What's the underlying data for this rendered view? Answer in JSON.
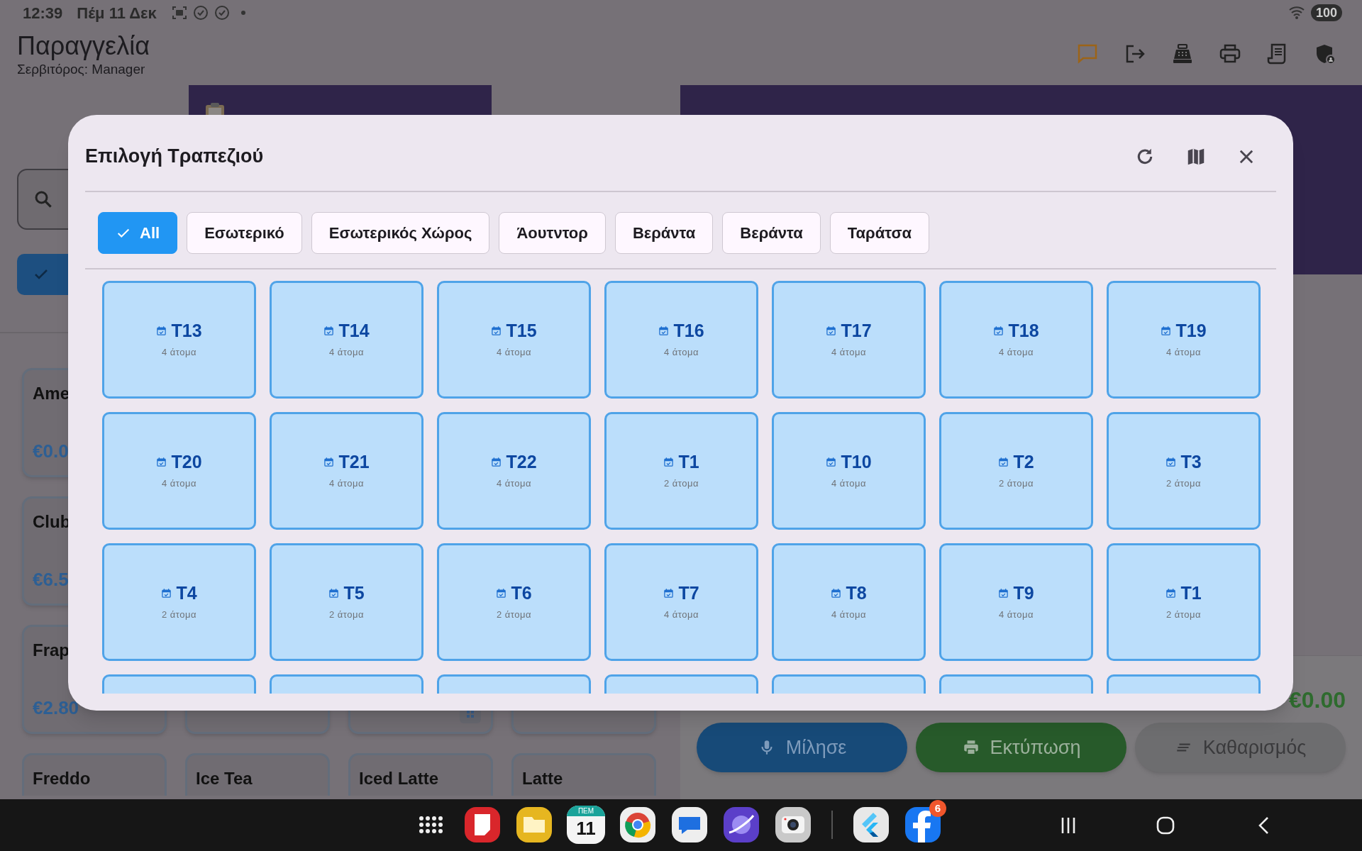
{
  "status_bar": {
    "time": "12:39",
    "date": "Πέμ 11 Δεκ",
    "battery": "100"
  },
  "header": {
    "title": "Παραγγελία",
    "subtitle": "Σερβιτόρος: Manager"
  },
  "catalog": {
    "product_rows": [
      [
        {
          "name": "Ame",
          "price": "€0.0"
        }
      ],
      [
        {
          "name": "Club",
          "price": "€6.5"
        }
      ],
      [
        {
          "name": "Frap",
          "price": "€2.80"
        },
        {},
        {},
        {}
      ],
      [
        {
          "name": "Freddo"
        },
        {
          "name": "Ice Tea"
        },
        {
          "name": "Iced Latte"
        },
        {
          "name": "Latte"
        }
      ]
    ]
  },
  "order": {
    "total": "€0.00",
    "buttons": [
      {
        "kind": "voice",
        "label": "Μίλησε"
      },
      {
        "kind": "print",
        "label": "Εκτύπωση"
      },
      {
        "kind": "clear",
        "label": "Καθαρισμός"
      }
    ]
  },
  "dialog": {
    "title": "Επιλογή Τραπεζιού",
    "filters": [
      {
        "label": "All",
        "selected": true
      },
      {
        "label": "Εσωτερικό",
        "selected": false
      },
      {
        "label": "Εσωτερικός Χώρος",
        "selected": false
      },
      {
        "label": "Άουτντορ",
        "selected": false
      },
      {
        "label": "Βεράντα",
        "selected": false
      },
      {
        "label": "Βεράντα",
        "selected": false
      },
      {
        "label": "Ταράτσα",
        "selected": false
      }
    ],
    "tables": [
      {
        "name": "T13",
        "seats": "4 άτομα"
      },
      {
        "name": "T14",
        "seats": "4 άτομα"
      },
      {
        "name": "T15",
        "seats": "4 άτομα"
      },
      {
        "name": "T16",
        "seats": "4 άτομα"
      },
      {
        "name": "T17",
        "seats": "4 άτομα"
      },
      {
        "name": "T18",
        "seats": "4 άτομα"
      },
      {
        "name": "T19",
        "seats": "4 άτομα"
      },
      {
        "name": "T20",
        "seats": "4 άτομα"
      },
      {
        "name": "T21",
        "seats": "4 άτομα"
      },
      {
        "name": "T22",
        "seats": "4 άτομα"
      },
      {
        "name": "T1",
        "seats": "2 άτομα"
      },
      {
        "name": "T10",
        "seats": "4 άτομα"
      },
      {
        "name": "T2",
        "seats": "2 άτομα"
      },
      {
        "name": "T3",
        "seats": "2 άτομα"
      },
      {
        "name": "T4",
        "seats": "2 άτομα"
      },
      {
        "name": "T5",
        "seats": "2 άτομα"
      },
      {
        "name": "T6",
        "seats": "2 άτομα"
      },
      {
        "name": "T7",
        "seats": "4 άτομα"
      },
      {
        "name": "T8",
        "seats": "4 άτομα"
      },
      {
        "name": "T9",
        "seats": "4 άτομα"
      },
      {
        "name": "T1",
        "seats": "2 άτομα"
      }
    ]
  },
  "dock": {
    "calendar_month": "ΠΕΜ",
    "calendar_day": "11",
    "facebook_badge": "6"
  }
}
